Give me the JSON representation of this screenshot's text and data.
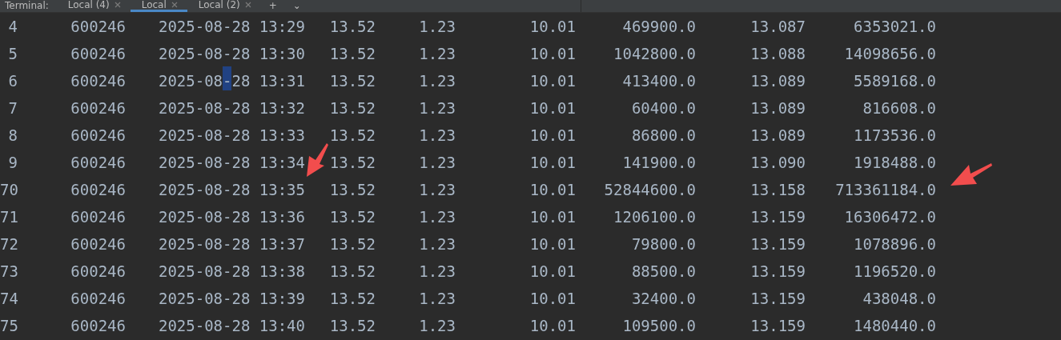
{
  "tab_bar": {
    "label": "Terminal:",
    "tabs": [
      {
        "label": "Local (4)",
        "selected": false
      },
      {
        "label": "Local",
        "selected": true
      },
      {
        "label": "Local (2)",
        "selected": false
      }
    ],
    "add_button": "+",
    "menu_button": "⌄"
  },
  "rows": [
    {
      "index": "4",
      "code": "600246",
      "datetime": "2025-08-28 13:29",
      "col_4": "13.52",
      "col_5": "1.23",
      "col_6": "10.01",
      "col_7": "469900.0",
      "col_8": "13.087",
      "col_9": "6353021.0",
      "cursor": false
    },
    {
      "index": "5",
      "code": "600246",
      "datetime": "2025-08-28 13:30",
      "col_4": "13.52",
      "col_5": "1.23",
      "col_6": "10.01",
      "col_7": "1042800.0",
      "col_8": "13.088",
      "col_9": "14098656.0",
      "cursor": false
    },
    {
      "index": "6",
      "code": "600246",
      "datetime": "2025-08-28 13:31",
      "col_4": "13.52",
      "col_5": "1.23",
      "col_6": "10.01",
      "col_7": "413400.0",
      "col_8": "13.089",
      "col_9": "5589168.0",
      "cursor": true
    },
    {
      "index": "7",
      "code": "600246",
      "datetime": "2025-08-28 13:32",
      "col_4": "13.52",
      "col_5": "1.23",
      "col_6": "10.01",
      "col_7": "60400.0",
      "col_8": "13.089",
      "col_9": "816608.0",
      "cursor": false
    },
    {
      "index": "8",
      "code": "600246",
      "datetime": "2025-08-28 13:33",
      "col_4": "13.52",
      "col_5": "1.23",
      "col_6": "10.01",
      "col_7": "86800.0",
      "col_8": "13.089",
      "col_9": "1173536.0",
      "cursor": false
    },
    {
      "index": "9",
      "code": "600246",
      "datetime": "2025-08-28 13:34",
      "col_4": "13.52",
      "col_5": "1.23",
      "col_6": "10.01",
      "col_7": "141900.0",
      "col_8": "13.090",
      "col_9": "1918488.0",
      "cursor": false
    },
    {
      "index": "70",
      "code": "600246",
      "datetime": "2025-08-28 13:35",
      "col_4": "13.52",
      "col_5": "1.23",
      "col_6": "10.01",
      "col_7": "52844600.0",
      "col_8": "13.158",
      "col_9": "713361184.0",
      "cursor": false
    },
    {
      "index": "71",
      "code": "600246",
      "datetime": "2025-08-28 13:36",
      "col_4": "13.52",
      "col_5": "1.23",
      "col_6": "10.01",
      "col_7": "1206100.0",
      "col_8": "13.159",
      "col_9": "16306472.0",
      "cursor": false
    },
    {
      "index": "72",
      "code": "600246",
      "datetime": "2025-08-28 13:37",
      "col_4": "13.52",
      "col_5": "1.23",
      "col_6": "10.01",
      "col_7": "79800.0",
      "col_8": "13.159",
      "col_9": "1078896.0",
      "cursor": false
    },
    {
      "index": "73",
      "code": "600246",
      "datetime": "2025-08-28 13:38",
      "col_4": "13.52",
      "col_5": "1.23",
      "col_6": "10.01",
      "col_7": "88500.0",
      "col_8": "13.159",
      "col_9": "1196520.0",
      "cursor": false
    },
    {
      "index": "74",
      "code": "600246",
      "datetime": "2025-08-28 13:39",
      "col_4": "13.52",
      "col_5": "1.23",
      "col_6": "10.01",
      "col_7": "32400.0",
      "col_8": "13.159",
      "col_9": "438048.0",
      "cursor": false
    },
    {
      "index": "75",
      "code": "600246",
      "datetime": "2025-08-28 13:40",
      "col_4": "13.52",
      "col_5": "1.23",
      "col_6": "10.01",
      "col_7": "109500.0",
      "col_8": "13.159",
      "col_9": "1480440.0",
      "cursor": false
    }
  ],
  "annotations": [
    {
      "kind": "arrow"
    },
    {
      "kind": "arrow"
    }
  ]
}
